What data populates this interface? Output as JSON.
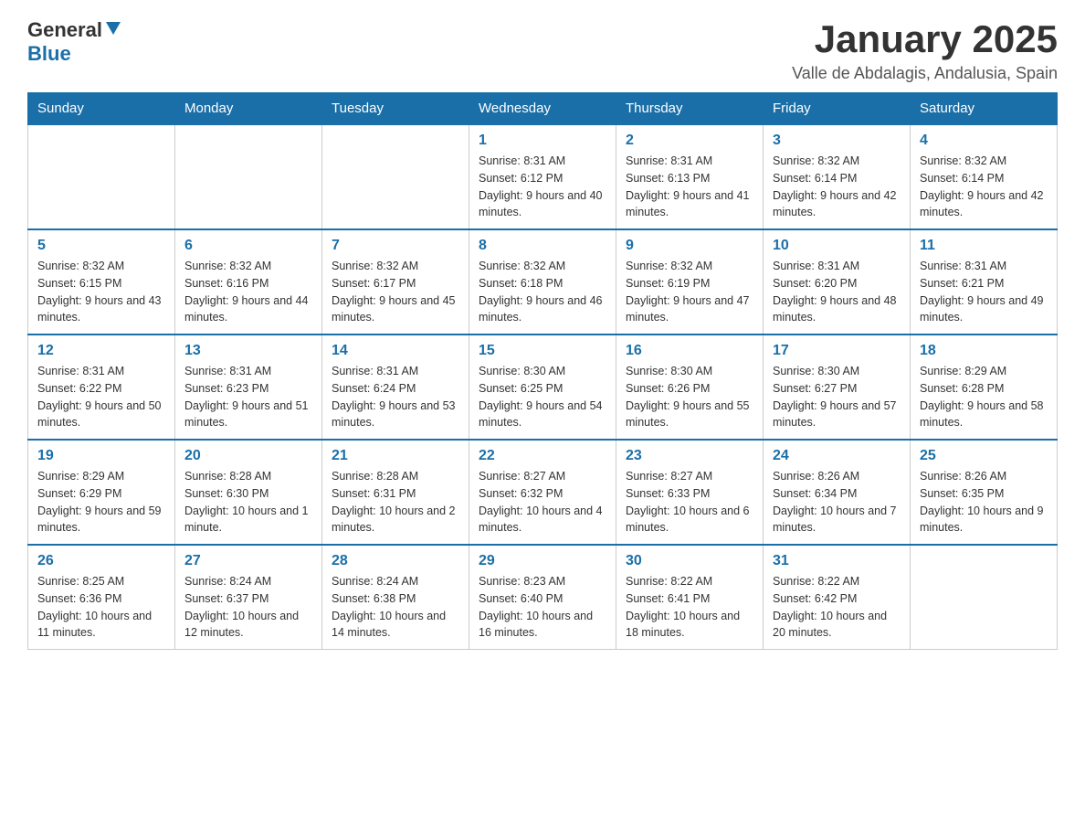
{
  "header": {
    "logo_general": "General",
    "logo_blue": "Blue",
    "month_title": "January 2025",
    "location": "Valle de Abdalagis, Andalusia, Spain"
  },
  "weekdays": [
    "Sunday",
    "Monday",
    "Tuesday",
    "Wednesday",
    "Thursday",
    "Friday",
    "Saturday"
  ],
  "weeks": [
    [
      {
        "day": "",
        "info": ""
      },
      {
        "day": "",
        "info": ""
      },
      {
        "day": "",
        "info": ""
      },
      {
        "day": "1",
        "info": "Sunrise: 8:31 AM\nSunset: 6:12 PM\nDaylight: 9 hours and 40 minutes."
      },
      {
        "day": "2",
        "info": "Sunrise: 8:31 AM\nSunset: 6:13 PM\nDaylight: 9 hours and 41 minutes."
      },
      {
        "day": "3",
        "info": "Sunrise: 8:32 AM\nSunset: 6:14 PM\nDaylight: 9 hours and 42 minutes."
      },
      {
        "day": "4",
        "info": "Sunrise: 8:32 AM\nSunset: 6:14 PM\nDaylight: 9 hours and 42 minutes."
      }
    ],
    [
      {
        "day": "5",
        "info": "Sunrise: 8:32 AM\nSunset: 6:15 PM\nDaylight: 9 hours and 43 minutes."
      },
      {
        "day": "6",
        "info": "Sunrise: 8:32 AM\nSunset: 6:16 PM\nDaylight: 9 hours and 44 minutes."
      },
      {
        "day": "7",
        "info": "Sunrise: 8:32 AM\nSunset: 6:17 PM\nDaylight: 9 hours and 45 minutes."
      },
      {
        "day": "8",
        "info": "Sunrise: 8:32 AM\nSunset: 6:18 PM\nDaylight: 9 hours and 46 minutes."
      },
      {
        "day": "9",
        "info": "Sunrise: 8:32 AM\nSunset: 6:19 PM\nDaylight: 9 hours and 47 minutes."
      },
      {
        "day": "10",
        "info": "Sunrise: 8:31 AM\nSunset: 6:20 PM\nDaylight: 9 hours and 48 minutes."
      },
      {
        "day": "11",
        "info": "Sunrise: 8:31 AM\nSunset: 6:21 PM\nDaylight: 9 hours and 49 minutes."
      }
    ],
    [
      {
        "day": "12",
        "info": "Sunrise: 8:31 AM\nSunset: 6:22 PM\nDaylight: 9 hours and 50 minutes."
      },
      {
        "day": "13",
        "info": "Sunrise: 8:31 AM\nSunset: 6:23 PM\nDaylight: 9 hours and 51 minutes."
      },
      {
        "day": "14",
        "info": "Sunrise: 8:31 AM\nSunset: 6:24 PM\nDaylight: 9 hours and 53 minutes."
      },
      {
        "day": "15",
        "info": "Sunrise: 8:30 AM\nSunset: 6:25 PM\nDaylight: 9 hours and 54 minutes."
      },
      {
        "day": "16",
        "info": "Sunrise: 8:30 AM\nSunset: 6:26 PM\nDaylight: 9 hours and 55 minutes."
      },
      {
        "day": "17",
        "info": "Sunrise: 8:30 AM\nSunset: 6:27 PM\nDaylight: 9 hours and 57 minutes."
      },
      {
        "day": "18",
        "info": "Sunrise: 8:29 AM\nSunset: 6:28 PM\nDaylight: 9 hours and 58 minutes."
      }
    ],
    [
      {
        "day": "19",
        "info": "Sunrise: 8:29 AM\nSunset: 6:29 PM\nDaylight: 9 hours and 59 minutes."
      },
      {
        "day": "20",
        "info": "Sunrise: 8:28 AM\nSunset: 6:30 PM\nDaylight: 10 hours and 1 minute."
      },
      {
        "day": "21",
        "info": "Sunrise: 8:28 AM\nSunset: 6:31 PM\nDaylight: 10 hours and 2 minutes."
      },
      {
        "day": "22",
        "info": "Sunrise: 8:27 AM\nSunset: 6:32 PM\nDaylight: 10 hours and 4 minutes."
      },
      {
        "day": "23",
        "info": "Sunrise: 8:27 AM\nSunset: 6:33 PM\nDaylight: 10 hours and 6 minutes."
      },
      {
        "day": "24",
        "info": "Sunrise: 8:26 AM\nSunset: 6:34 PM\nDaylight: 10 hours and 7 minutes."
      },
      {
        "day": "25",
        "info": "Sunrise: 8:26 AM\nSunset: 6:35 PM\nDaylight: 10 hours and 9 minutes."
      }
    ],
    [
      {
        "day": "26",
        "info": "Sunrise: 8:25 AM\nSunset: 6:36 PM\nDaylight: 10 hours and 11 minutes."
      },
      {
        "day": "27",
        "info": "Sunrise: 8:24 AM\nSunset: 6:37 PM\nDaylight: 10 hours and 12 minutes."
      },
      {
        "day": "28",
        "info": "Sunrise: 8:24 AM\nSunset: 6:38 PM\nDaylight: 10 hours and 14 minutes."
      },
      {
        "day": "29",
        "info": "Sunrise: 8:23 AM\nSunset: 6:40 PM\nDaylight: 10 hours and 16 minutes."
      },
      {
        "day": "30",
        "info": "Sunrise: 8:22 AM\nSunset: 6:41 PM\nDaylight: 10 hours and 18 minutes."
      },
      {
        "day": "31",
        "info": "Sunrise: 8:22 AM\nSunset: 6:42 PM\nDaylight: 10 hours and 20 minutes."
      },
      {
        "day": "",
        "info": ""
      }
    ]
  ]
}
